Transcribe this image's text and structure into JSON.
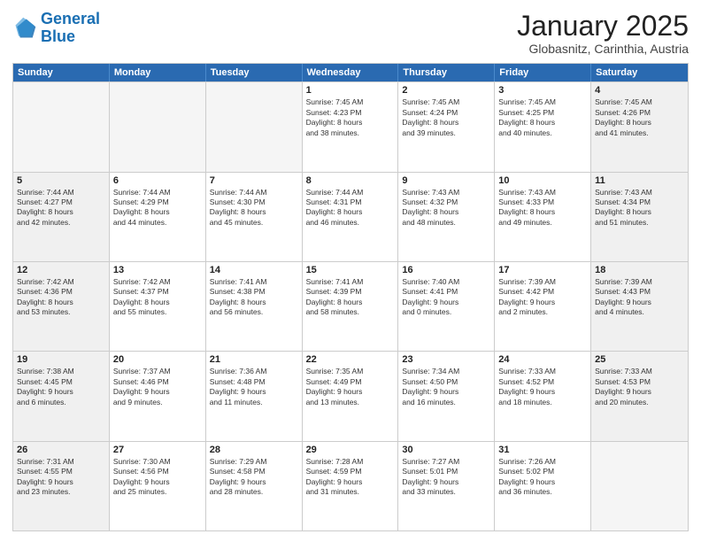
{
  "logo": {
    "line1": "General",
    "line2": "Blue"
  },
  "title": "January 2025",
  "location": "Globasnitz, Carinthia, Austria",
  "days_of_week": [
    "Sunday",
    "Monday",
    "Tuesday",
    "Wednesday",
    "Thursday",
    "Friday",
    "Saturday"
  ],
  "rows": [
    [
      {
        "day": "",
        "text": "",
        "empty": true
      },
      {
        "day": "",
        "text": "",
        "empty": true
      },
      {
        "day": "",
        "text": "",
        "empty": true
      },
      {
        "day": "1",
        "text": "Sunrise: 7:45 AM\nSunset: 4:23 PM\nDaylight: 8 hours\nand 38 minutes."
      },
      {
        "day": "2",
        "text": "Sunrise: 7:45 AM\nSunset: 4:24 PM\nDaylight: 8 hours\nand 39 minutes."
      },
      {
        "day": "3",
        "text": "Sunrise: 7:45 AM\nSunset: 4:25 PM\nDaylight: 8 hours\nand 40 minutes."
      },
      {
        "day": "4",
        "text": "Sunrise: 7:45 AM\nSunset: 4:26 PM\nDaylight: 8 hours\nand 41 minutes.",
        "shaded": true
      }
    ],
    [
      {
        "day": "5",
        "text": "Sunrise: 7:44 AM\nSunset: 4:27 PM\nDaylight: 8 hours\nand 42 minutes.",
        "shaded": true
      },
      {
        "day": "6",
        "text": "Sunrise: 7:44 AM\nSunset: 4:29 PM\nDaylight: 8 hours\nand 44 minutes."
      },
      {
        "day": "7",
        "text": "Sunrise: 7:44 AM\nSunset: 4:30 PM\nDaylight: 8 hours\nand 45 minutes."
      },
      {
        "day": "8",
        "text": "Sunrise: 7:44 AM\nSunset: 4:31 PM\nDaylight: 8 hours\nand 46 minutes."
      },
      {
        "day": "9",
        "text": "Sunrise: 7:43 AM\nSunset: 4:32 PM\nDaylight: 8 hours\nand 48 minutes."
      },
      {
        "day": "10",
        "text": "Sunrise: 7:43 AM\nSunset: 4:33 PM\nDaylight: 8 hours\nand 49 minutes."
      },
      {
        "day": "11",
        "text": "Sunrise: 7:43 AM\nSunset: 4:34 PM\nDaylight: 8 hours\nand 51 minutes.",
        "shaded": true
      }
    ],
    [
      {
        "day": "12",
        "text": "Sunrise: 7:42 AM\nSunset: 4:36 PM\nDaylight: 8 hours\nand 53 minutes.",
        "shaded": true
      },
      {
        "day": "13",
        "text": "Sunrise: 7:42 AM\nSunset: 4:37 PM\nDaylight: 8 hours\nand 55 minutes."
      },
      {
        "day": "14",
        "text": "Sunrise: 7:41 AM\nSunset: 4:38 PM\nDaylight: 8 hours\nand 56 minutes."
      },
      {
        "day": "15",
        "text": "Sunrise: 7:41 AM\nSunset: 4:39 PM\nDaylight: 8 hours\nand 58 minutes."
      },
      {
        "day": "16",
        "text": "Sunrise: 7:40 AM\nSunset: 4:41 PM\nDaylight: 9 hours\nand 0 minutes."
      },
      {
        "day": "17",
        "text": "Sunrise: 7:39 AM\nSunset: 4:42 PM\nDaylight: 9 hours\nand 2 minutes."
      },
      {
        "day": "18",
        "text": "Sunrise: 7:39 AM\nSunset: 4:43 PM\nDaylight: 9 hours\nand 4 minutes.",
        "shaded": true
      }
    ],
    [
      {
        "day": "19",
        "text": "Sunrise: 7:38 AM\nSunset: 4:45 PM\nDaylight: 9 hours\nand 6 minutes.",
        "shaded": true
      },
      {
        "day": "20",
        "text": "Sunrise: 7:37 AM\nSunset: 4:46 PM\nDaylight: 9 hours\nand 9 minutes."
      },
      {
        "day": "21",
        "text": "Sunrise: 7:36 AM\nSunset: 4:48 PM\nDaylight: 9 hours\nand 11 minutes."
      },
      {
        "day": "22",
        "text": "Sunrise: 7:35 AM\nSunset: 4:49 PM\nDaylight: 9 hours\nand 13 minutes."
      },
      {
        "day": "23",
        "text": "Sunrise: 7:34 AM\nSunset: 4:50 PM\nDaylight: 9 hours\nand 16 minutes."
      },
      {
        "day": "24",
        "text": "Sunrise: 7:33 AM\nSunset: 4:52 PM\nDaylight: 9 hours\nand 18 minutes."
      },
      {
        "day": "25",
        "text": "Sunrise: 7:33 AM\nSunset: 4:53 PM\nDaylight: 9 hours\nand 20 minutes.",
        "shaded": true
      }
    ],
    [
      {
        "day": "26",
        "text": "Sunrise: 7:31 AM\nSunset: 4:55 PM\nDaylight: 9 hours\nand 23 minutes.",
        "shaded": true
      },
      {
        "day": "27",
        "text": "Sunrise: 7:30 AM\nSunset: 4:56 PM\nDaylight: 9 hours\nand 25 minutes."
      },
      {
        "day": "28",
        "text": "Sunrise: 7:29 AM\nSunset: 4:58 PM\nDaylight: 9 hours\nand 28 minutes."
      },
      {
        "day": "29",
        "text": "Sunrise: 7:28 AM\nSunset: 4:59 PM\nDaylight: 9 hours\nand 31 minutes."
      },
      {
        "day": "30",
        "text": "Sunrise: 7:27 AM\nSunset: 5:01 PM\nDaylight: 9 hours\nand 33 minutes."
      },
      {
        "day": "31",
        "text": "Sunrise: 7:26 AM\nSunset: 5:02 PM\nDaylight: 9 hours\nand 36 minutes."
      },
      {
        "day": "",
        "text": "",
        "empty": true
      }
    ]
  ]
}
